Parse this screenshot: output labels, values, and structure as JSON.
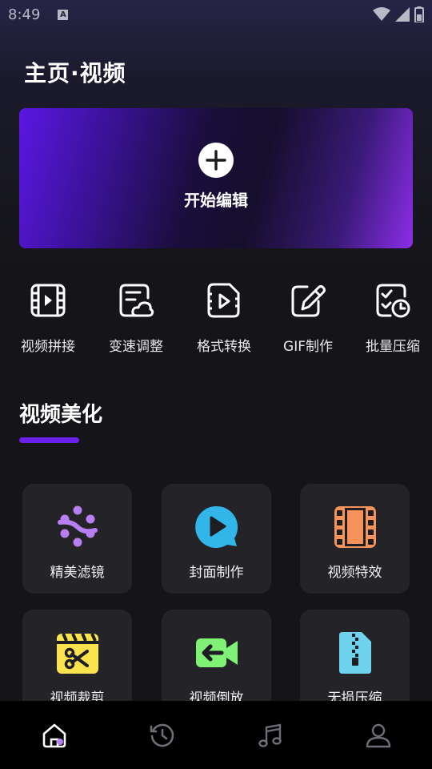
{
  "status_bar": {
    "time": "8:49",
    "notification_icon": "a-icon",
    "icons": [
      "wifi-icon",
      "signal-icon",
      "battery-icon"
    ]
  },
  "page_title": "主页·视频",
  "hero": {
    "icon": "plus-icon",
    "label": "开始编辑"
  },
  "tools": [
    {
      "label": "视频拼接",
      "icon": "film-strip-icon"
    },
    {
      "label": "变速调整",
      "icon": "document-cloud-icon"
    },
    {
      "label": "格式转换",
      "icon": "video-file-icon"
    },
    {
      "label": "GIF制作",
      "icon": "edit-pencil-icon"
    },
    {
      "label": "批量压缩",
      "icon": "checklist-clock-icon"
    }
  ],
  "section": {
    "title": "视频美化"
  },
  "cards": [
    {
      "label": "精美滤镜",
      "icon": "filter-dots-icon"
    },
    {
      "label": "封面制作",
      "icon": "play-bubble-icon"
    },
    {
      "label": "视频特效",
      "icon": "film-icon"
    },
    {
      "label": "视频裁剪",
      "icon": "clapper-scissors-icon"
    },
    {
      "label": "视频倒放",
      "icon": "camera-reverse-icon"
    },
    {
      "label": "无损压缩",
      "icon": "zip-file-icon"
    }
  ],
  "bottom_nav": [
    {
      "name": "home",
      "icon": "home-icon",
      "active": true
    },
    {
      "name": "history",
      "icon": "history-icon",
      "active": false
    },
    {
      "name": "music",
      "icon": "music-icon",
      "active": false
    },
    {
      "name": "profile",
      "icon": "user-icon",
      "active": false
    }
  ],
  "colors": {
    "accent": "#6a22e8",
    "background": "#151519",
    "card": "#232328",
    "nav": "#000000"
  }
}
